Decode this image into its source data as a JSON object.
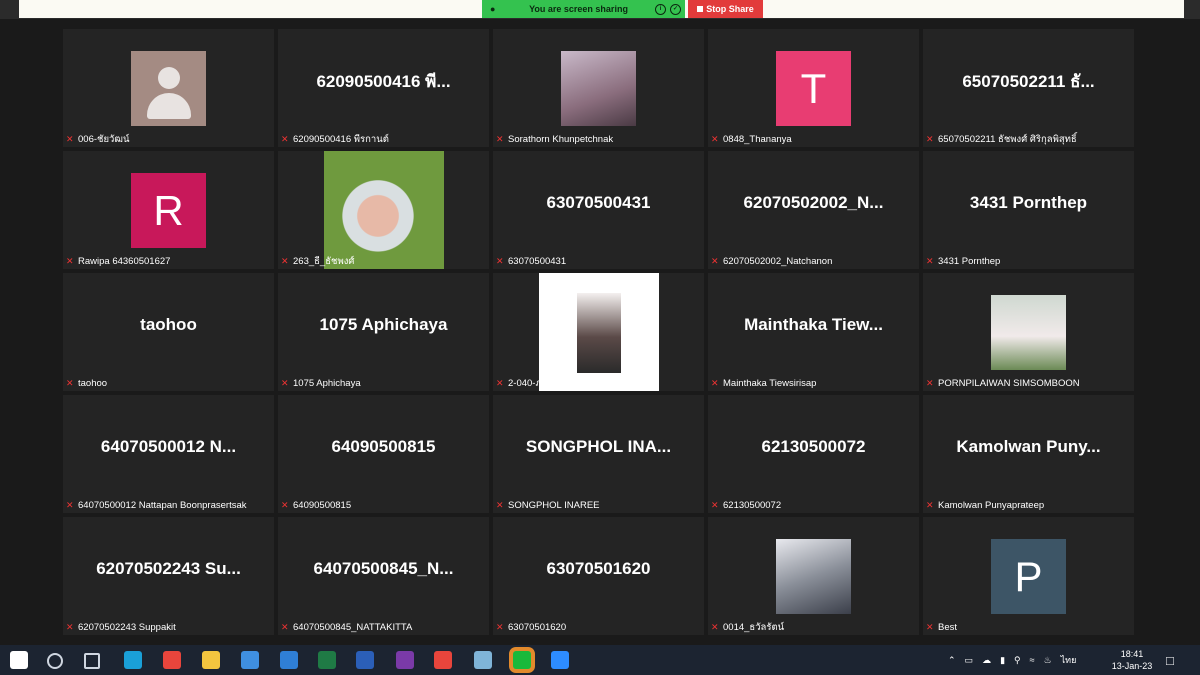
{
  "share_bar": {
    "status": "You are screen sharing",
    "stop_label": "Stop Share"
  },
  "tiles": [
    {
      "display": "",
      "label": "006-ชัยวัฒน์",
      "kind": "avatar-placeholder"
    },
    {
      "display": "62090500416 พี...",
      "label": "62090500416 พีรกานต์",
      "kind": "text"
    },
    {
      "display": "",
      "label": "Sorathorn Khunpetchnak",
      "kind": "photo-anime"
    },
    {
      "display": "",
      "label": "0848_Thananya",
      "kind": "initial",
      "initial": "T",
      "color": "#e83d72"
    },
    {
      "display": "65070502211 ธั...",
      "label": "65070502211 ธัชพงศ์ ศิริกุลพิสุทธิ์",
      "kind": "text"
    },
    {
      "display": "",
      "label": "Rawipa 64360501627",
      "kind": "initial",
      "initial": "R",
      "color": "#c8185a"
    },
    {
      "display": "",
      "label": "263_ธี_ธัชพงศ์",
      "kind": "photo-cartoon"
    },
    {
      "display": "63070500431",
      "label": "63070500431",
      "kind": "text"
    },
    {
      "display": "62070502002_N...",
      "label": "62070502002_Natchanon",
      "kind": "text"
    },
    {
      "display": "3431 Pornthep",
      "label": "3431 Pornthep",
      "kind": "text"
    },
    {
      "display": "taohoo",
      "label": "taohoo",
      "kind": "text"
    },
    {
      "display": "1075 Aphichaya",
      "label": "1075 Aphichaya",
      "kind": "text"
    },
    {
      "display": "",
      "label": "2-040-ภรภัทร บารวงศ์วัฒนา",
      "kind": "photo-selfie"
    },
    {
      "display": "Mainthaka Tiew...",
      "label": "Mainthaka Tiewsirisap",
      "kind": "text"
    },
    {
      "display": "",
      "label": "PORNPILAIWAN SIMSOMBOON",
      "kind": "photo-portrait"
    },
    {
      "display": "64070500012 N...",
      "label": "64070500012 Nattapan Boonprasertsak",
      "kind": "text"
    },
    {
      "display": "64090500815",
      "label": "64090500815",
      "kind": "text"
    },
    {
      "display": "SONGPHOL INA...",
      "label": "SONGPHOL INAREE",
      "kind": "text"
    },
    {
      "display": "62130500072",
      "label": "62130500072",
      "kind": "text"
    },
    {
      "display": "Kamolwan Puny...",
      "label": "Kamolwan Punyaprateep",
      "kind": "text"
    },
    {
      "display": "62070502243 Su...",
      "label": "62070502243 Suppakit",
      "kind": "text"
    },
    {
      "display": "64070500845_N...",
      "label": "64070500845_NATTAKITTA",
      "kind": "text"
    },
    {
      "display": "63070501620",
      "label": "63070501620",
      "kind": "text"
    },
    {
      "display": "",
      "label": "0014_ธวัลรัตน์",
      "kind": "photo-snow"
    },
    {
      "display": "",
      "label": "Best",
      "kind": "initial",
      "initial": "P",
      "color": "#3d5566"
    }
  ],
  "taskbar": {
    "apps": [
      "windows-icon",
      "search-icon",
      "task-view-icon",
      "edge-icon",
      "chrome-icon",
      "file-explorer-icon",
      "store-icon",
      "mail-icon",
      "excel-icon",
      "word-icon",
      "onenote-icon",
      "chrome-icon",
      "notepad-icon",
      "line-icon",
      "zoom-icon"
    ],
    "lang": "ไทย",
    "time": "18:41",
    "date": "13-Jan-23"
  },
  "colors": {
    "stop": "#e23b3b",
    "share": "#34c24f",
    "tile_bg": "#242424"
  }
}
